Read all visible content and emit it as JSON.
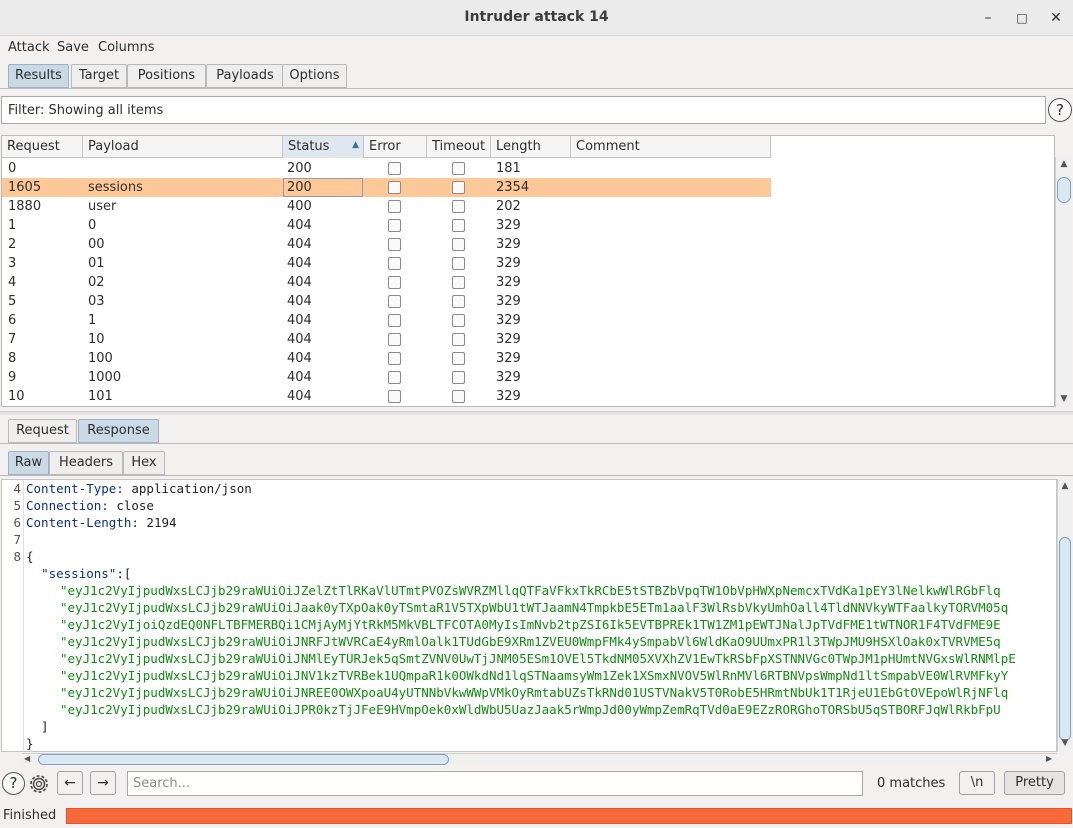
{
  "window": {
    "title": "Intruder attack 14",
    "minimize": "–",
    "maximize": "□",
    "close": "✕"
  },
  "menu": [
    "Attack",
    "Save",
    "Columns"
  ],
  "main_tabs": [
    "Results",
    "Target",
    "Positions",
    "Payloads",
    "Options"
  ],
  "filter": {
    "text": "Filter: Showing all items",
    "help": "?"
  },
  "table": {
    "columns": [
      "Request",
      "Payload",
      "Status",
      "Error",
      "Timeout",
      "Length",
      "Comment"
    ],
    "sort_indicator": "▲",
    "rows": [
      {
        "request": "0",
        "payload": "",
        "status": "200",
        "length": "181"
      },
      {
        "request": "1605",
        "payload": "sessions",
        "status": "200",
        "length": "2354"
      },
      {
        "request": "1880",
        "payload": "user",
        "status": "400",
        "length": "202"
      },
      {
        "request": "1",
        "payload": "0",
        "status": "404",
        "length": "329"
      },
      {
        "request": "2",
        "payload": "00",
        "status": "404",
        "length": "329"
      },
      {
        "request": "3",
        "payload": "01",
        "status": "404",
        "length": "329"
      },
      {
        "request": "4",
        "payload": "02",
        "status": "404",
        "length": "329"
      },
      {
        "request": "5",
        "payload": "03",
        "status": "404",
        "length": "329"
      },
      {
        "request": "6",
        "payload": "1",
        "status": "404",
        "length": "329"
      },
      {
        "request": "7",
        "payload": "10",
        "status": "404",
        "length": "329"
      },
      {
        "request": "8",
        "payload": "100",
        "status": "404",
        "length": "329"
      },
      {
        "request": "9",
        "payload": "1000",
        "status": "404",
        "length": "329"
      },
      {
        "request": "10",
        "payload": "101",
        "status": "404",
        "length": "329"
      }
    ]
  },
  "detail_tabs": [
    "Request",
    "Response"
  ],
  "view_tabs": [
    "Raw",
    "Headers",
    "Hex"
  ],
  "response": {
    "lines": [
      {
        "n": "4",
        "key": "Content-Type:",
        "val": " application/json"
      },
      {
        "n": "5",
        "key": "Connection:",
        "val": " close"
      },
      {
        "n": "6",
        "key": "Content-Length:",
        "val": " 2194"
      },
      {
        "n": "7",
        "key": "",
        "val": ""
      },
      {
        "n": "8",
        "key": "",
        "val": "{"
      }
    ],
    "sessions_key": "\"sessions\"",
    "sessions_open": ":[",
    "sessions": [
      "\"eyJ1c2VyIjpudWxsLCJjb29raWUiOiJZelZtTlRKaVlUTmtPVOZsWVRZMllqQTFaVFkxTkRCbE5tSTBZbVpqTW1ObVpHWXpNemcxTVdKa1pEY3lNelkwWlRGbFlq",
      "\"eyJ1c2VyIjpudWxsLCJjb29raWUiOiJaak0yTXpOak0yTSmtaR1V5TXpWbU1tWTJaamN4TmpkbE5ETm1aalF3WlRsbVkyUmhOall4TldNNVkyWTFaalkyTORVM05q",
      "\"eyJ1c2VyIjoiQzdEQ0NFLTBFMERBQi1CMjAyMjYtRkM5MkVBLTFCOTA0MyIsImNvb2tpZSI6Ik5EVTBPREk1TW1ZM1pEWTJNalJpTVdFME1tWTNOR1F4TVdFME9E",
      "\"eyJ1c2VyIjpudWxsLCJjb29raWUiOiJNRFJtWVRCaE4yRmlOalk1TUdGbE9XRm1ZVEU0WmpFMk4ySmpabVl6WldKaO9UUmxPR1l3TWpJMU9HSXlOak0xTVRVME5q",
      "\"eyJ1c2VyIjpudWxsLCJjb29raWUiOiJNMlEyTURJek5qSmtZVNV0UwTjJNM05ESm1OVEl5TkdNM05XVXhZV1EwTkRSbFpXSTNNVGc0TWpJM1pHUmtNVGxsWlRNMlpE",
      "\"eyJ1c2VyIjpudWxsLCJjb29raWUiOiJNV1kzTVRBek1UQmpaR1k0OWkdNd1lqSTNaamsyWm1Zek1XSmxNVOV5WlRnMVl6RTBNVpsWmpNd1ltSmpabVE0WlRVMFkyY",
      "\"eyJ1c2VyIjpudWxsLCJjb29raWUiOiJNREE0OWXpoaU4yUTNNbVkwWWpVMkOyRmtabUZsTkRNd01USTVNakV5T0RobE5HRmtNbUk1T1RjeU1EbGtOVEpoWlRjNFlq",
      "\"eyJ1c2VyIjpudWxsLCJjb29raWUiOiJPR0kzTjJFeE9HVmpOek0xWldWbU5UazJaak5rWmpJd00yWmpZemRqTVd0aE9EZzRORGhoTORSbU5qSTBORFJqWlRkbFpU"
    ],
    "close_array": "  ]",
    "close_obj": "}"
  },
  "search": {
    "placeholder": "Search...",
    "matches": "0 matches",
    "newline_btn": "\\n",
    "pretty_btn": "Pretty",
    "help": "?"
  },
  "status": {
    "text": "Finished",
    "progress_pct": 100,
    "progress_color": "#f7693a"
  }
}
